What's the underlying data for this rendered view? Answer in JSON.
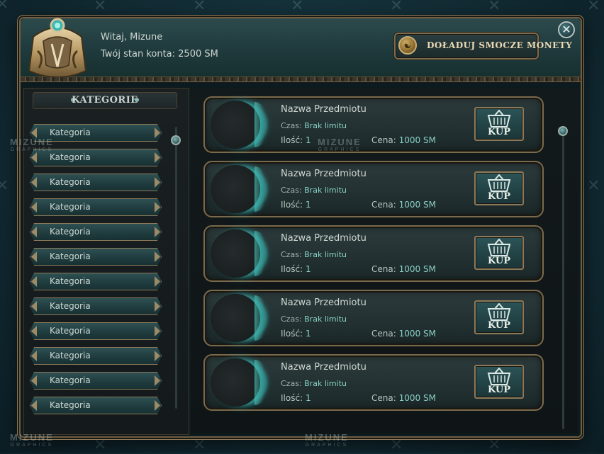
{
  "header": {
    "greeting": "Witaj, Mizune",
    "balance": "Twój stan konta: 2500 SM",
    "recharge_label": "DOŁADUJ SMOCZE MONETY"
  },
  "sidebar": {
    "title": "KATEGORIE",
    "items": [
      {
        "label": "Kategoria"
      },
      {
        "label": "Kategoria"
      },
      {
        "label": "Kategoria"
      },
      {
        "label": "Kategoria"
      },
      {
        "label": "Kategoria"
      },
      {
        "label": "Kategoria"
      },
      {
        "label": "Kategoria"
      },
      {
        "label": "Kategoria"
      },
      {
        "label": "Kategoria"
      },
      {
        "label": "Kategoria"
      },
      {
        "label": "Kategoria"
      },
      {
        "label": "Kategoria"
      }
    ]
  },
  "items": [
    {
      "name": "Nazwa Przedmiotu",
      "time_label": "Czas:",
      "time": "Brak limitu",
      "qty_label": "Ilość:",
      "qty": "1",
      "price_label": "Cena:",
      "price": "1000 SM",
      "buy_label": "KUP"
    },
    {
      "name": "Nazwa Przedmiotu",
      "time_label": "Czas:",
      "time": "Brak limitu",
      "qty_label": "Ilość:",
      "qty": "1",
      "price_label": "Cena:",
      "price": "1000 SM",
      "buy_label": "KUP"
    },
    {
      "name": "Nazwa Przedmiotu",
      "time_label": "Czas:",
      "time": "Brak limitu",
      "qty_label": "Ilość:",
      "qty": "1",
      "price_label": "Cena:",
      "price": "1000 SM",
      "buy_label": "KUP"
    },
    {
      "name": "Nazwa Przedmiotu",
      "time_label": "Czas:",
      "time": "Brak limitu",
      "qty_label": "Ilość:",
      "qty": "1",
      "price_label": "Cena:",
      "price": "1000 SM",
      "buy_label": "KUP"
    },
    {
      "name": "Nazwa Przedmiotu",
      "time_label": "Czas:",
      "time": "Brak limitu",
      "qty_label": "Ilość:",
      "qty": "1",
      "price_label": "Cena:",
      "price": "1000 SM",
      "buy_label": "KUP"
    }
  ],
  "watermark": {
    "brand": "MIZUNE",
    "sub": "GRAPHICS"
  },
  "colors": {
    "accent": "#88d0c4",
    "gold_border": "#8b7a59",
    "panel": "#223031"
  }
}
